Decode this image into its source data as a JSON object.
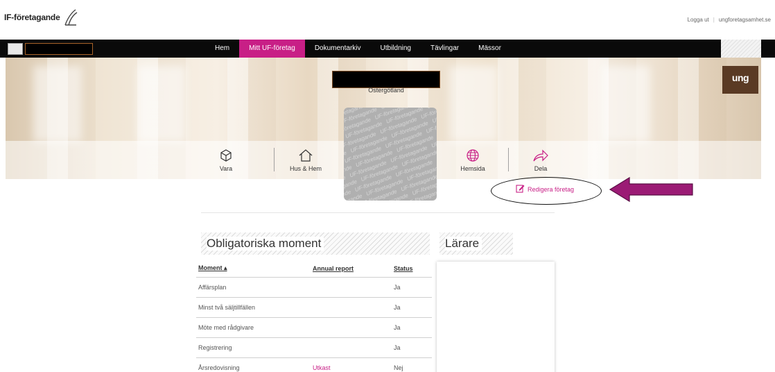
{
  "brand": {
    "name": "IF-företagande"
  },
  "top_links": {
    "logout": "Logga ut",
    "separator": "|",
    "site": "ungforetagsamhet.se"
  },
  "nav": {
    "items": [
      {
        "label": "Hem",
        "active": false
      },
      {
        "label": "Mitt UF-företag",
        "active": true
      },
      {
        "label": "Dokumentarkiv",
        "active": false
      },
      {
        "label": "Utbildning",
        "active": false
      },
      {
        "label": "Tävlingar",
        "active": false
      },
      {
        "label": "Mässor",
        "active": false
      }
    ],
    "active_color": "#c81f86"
  },
  "hero": {
    "region": "Östergötland",
    "badge": "ung"
  },
  "categories": [
    {
      "label": "Vara",
      "icon": "cube-icon"
    },
    {
      "label": "Hus & Hem",
      "icon": "house-icon"
    },
    {
      "label": "Hemsida",
      "icon": "globe-icon"
    },
    {
      "label": "Dela",
      "icon": "share-arrow-icon"
    }
  ],
  "logo_watermark": "UF-företagande",
  "edit_link": "Redigera företag",
  "sections": {
    "obligatory": "Obligatoriska moment",
    "teachers": "Lärare"
  },
  "table": {
    "headers": {
      "moment": "Moment ▴",
      "annual": "Annual report",
      "status": "Status"
    },
    "rows": [
      {
        "moment": "Affärsplan",
        "annual": "",
        "status": "Ja"
      },
      {
        "moment": "Minst två säljtillfällen",
        "annual": "",
        "status": "Ja"
      },
      {
        "moment": "Möte med rådgivare",
        "annual": "",
        "status": "Ja"
      },
      {
        "moment": "Registrering",
        "annual": "",
        "status": "Ja"
      },
      {
        "moment": "Årsredovisning",
        "annual": "Utkast",
        "status": "Nej"
      }
    ]
  },
  "colors": {
    "accent": "#c81f86",
    "annotation_arrow": "#9b1b75"
  }
}
